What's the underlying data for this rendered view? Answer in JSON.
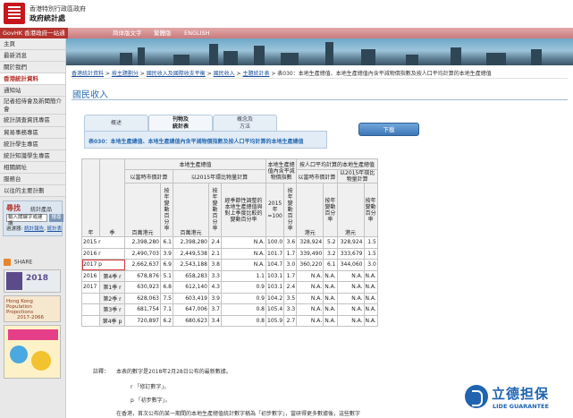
{
  "header": {
    "org_line1": "香港特別行政區政府",
    "org_line2": "政府統計處"
  },
  "navbar": {
    "gov_link": "GovHK 香港政府一站通",
    "lang_links": [
      "简体版文字",
      "繁體版",
      "ENGLISH"
    ]
  },
  "sidebar": {
    "items": [
      {
        "label": "主頁",
        "active": false
      },
      {
        "label": "最新消息",
        "active": false
      },
      {
        "label": "關於我們",
        "active": false
      },
      {
        "label": "香港統計資料",
        "active": true
      },
      {
        "label": "通知站",
        "active": false
      },
      {
        "label": "記者招待會及新聞簡介會",
        "active": false,
        "two_line": true
      },
      {
        "label": "統計調查資訊專區",
        "active": false
      },
      {
        "label": "貿易事務專區",
        "active": false
      },
      {
        "label": "統計學生專區",
        "active": false
      },
      {
        "label": "統計知識學生專區",
        "active": false
      },
      {
        "label": "相關網址",
        "active": false
      },
      {
        "label": "服務台",
        "active": false
      },
      {
        "label": "以往的主要計劃",
        "active": false
      }
    ],
    "search": {
      "title": "尋找",
      "subtitle": "統計產品",
      "placeholder": "輸入關鍵字或建議",
      "go_label": "搜尋",
      "filter_label": "過濾器:",
      "filter_link1": "統計報告",
      "filter_link2": "統計表"
    },
    "share_label": "SHARE",
    "promo_texts": [
      "2018",
      "Hong Kong Population Projections",
      "2017-2066"
    ]
  },
  "breadcrumb": {
    "items": [
      "香港統計資料",
      "按主題劃分",
      "國民收入及國際收支平衡",
      "國民收入",
      "主題統計表",
      "表030：本地生產總值、本地生產總值內含平減物價指數及按人口平均計算的本地生產總值"
    ]
  },
  "page_title": "國民收入",
  "tabs": [
    {
      "label1": "概述",
      "label2": "",
      "active": false
    },
    {
      "label1": "刊物及",
      "label2": "統計表",
      "active": true
    },
    {
      "label1": "概念及",
      "label2": "方法",
      "active": false
    }
  ],
  "panel_title": "表030：本地生產總值、本地生產總值內含平減物價指數及按人口平均計算的本地生產總值",
  "download_label": "下載",
  "table": {
    "group_gdp": "本地生產總值",
    "group_deflator": "本地生產總值內含平減物價指數",
    "group_percap": "按人口平均計算的本地生產總值",
    "sub_current": "以當時市價計算",
    "sub_chained": "以2015年環比物量計算",
    "sub_percap_current": "以當時市價計算",
    "sub_percap_chained": "以2015年環比物量計算",
    "col_year": "年",
    "col_quarter": "季",
    "col_hkd_mn": "百萬港元",
    "col_yoy_pct": "按年變動百分率",
    "col_hkd_mn2": "百萬港元",
    "col_yoy_pct2": "按年變動百分率",
    "col_sa_qoq": "經季節性調整的本地生產總值與對上季度比較的變動百分率",
    "col_index": "2015年=100",
    "col_yoy_pct3": "按年變動百分率",
    "col_hkd": "港元",
    "col_yoy_pct4": "按年變動百分率",
    "col_hkd2": "港元",
    "col_yoy_pct5": "按年變動百分率",
    "rows": [
      {
        "year": "2015 r",
        "q": "",
        "v": [
          "2,398,280",
          "6.1",
          "2,398,280",
          "2.4",
          "N.A.",
          "100.0",
          "3.6",
          "328,924",
          "5.2",
          "328,924",
          "1.5"
        ],
        "annual": true
      },
      {
        "year": "2016 r",
        "q": "",
        "v": [
          "2,490,703",
          "3.9",
          "2,449,538",
          "2.1",
          "N.A.",
          "101.7",
          "1.7",
          "339,490",
          "3.2",
          "333,679",
          "1.5"
        ],
        "annual": true
      },
      {
        "year": "2017 p",
        "q": "",
        "v": [
          "2,662,637",
          "6.9",
          "2,543,188",
          "3.8",
          "N.A.",
          "104.7",
          "3.0",
          "360,220",
          "6.1",
          "344,060",
          "3.0"
        ],
        "annual": true,
        "highlight": true
      },
      {
        "year": "2016",
        "q": "第4季 r",
        "v": [
          "678,876",
          "5.1",
          "658,283",
          "3.3",
          "1.1",
          "103.1",
          "1.7",
          "N.A.",
          "N.A.",
          "N.A.",
          "N.A."
        ]
      },
      {
        "year": "2017",
        "q": "第1季 r",
        "v": [
          "630,923",
          "6.8",
          "612,140",
          "4.3",
          "0.9",
          "103.1",
          "2.4",
          "N.A.",
          "N.A.",
          "N.A.",
          "N.A."
        ]
      },
      {
        "year": "",
        "q": "第2季 r",
        "v": [
          "628,063",
          "7.5",
          "603,419",
          "3.9",
          "0.9",
          "104.2",
          "3.5",
          "N.A.",
          "N.A.",
          "N.A.",
          "N.A."
        ]
      },
      {
        "year": "",
        "q": "第3季 r",
        "v": [
          "681,754",
          "7.1",
          "647,006",
          "3.7",
          "0.8",
          "105.4",
          "3.3",
          "N.A.",
          "N.A.",
          "N.A.",
          "N.A."
        ]
      },
      {
        "year": "",
        "q": "第4季 p",
        "v": [
          "720,897",
          "6.2",
          "680,623",
          "3.4",
          "0.8",
          "105.9",
          "2.7",
          "N.A.",
          "N.A.",
          "N.A.",
          "N.A."
        ]
      }
    ]
  },
  "notes": {
    "label": "註釋：",
    "line1": "本表的數字是2018年2月28日公布的最新數據。",
    "line2": "r 「修訂數字」。",
    "line3": "p 「初步數字」。",
    "line4": "在香港，首次公布的某一期間的本地生產總值統計數字稱為「初步數字」，當研得更多數據後，這些數字"
  },
  "watermark": {
    "cn": "立德担保",
    "en": "LIDE GUARANTEE"
  },
  "colors": {
    "brand_red": "#b5342f",
    "link_blue": "#1a4f9c",
    "title_blue": "#2b6db3",
    "highlight_red": "#d23a3a",
    "watermark_blue": "#2064b0"
  }
}
